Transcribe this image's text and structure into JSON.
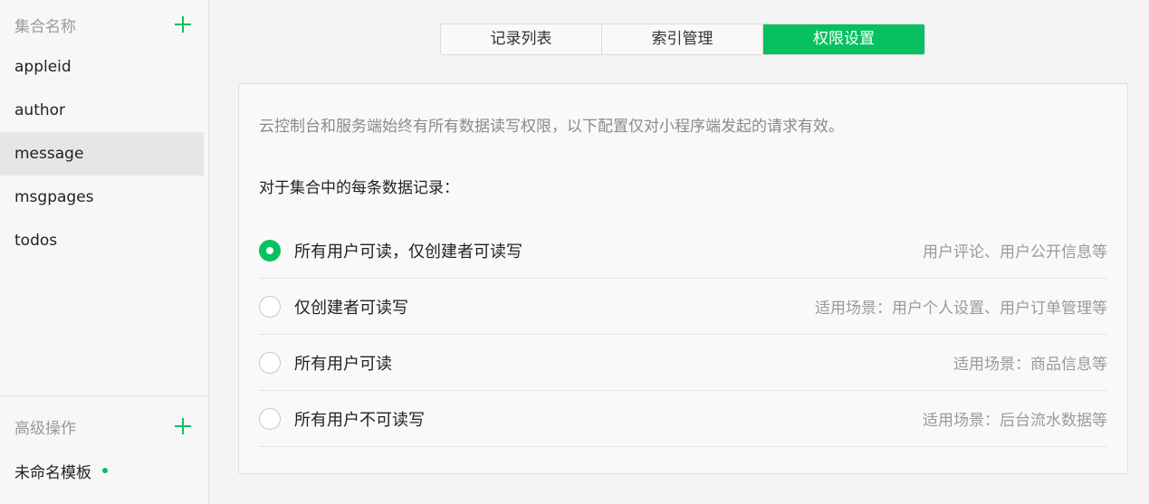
{
  "sidebar": {
    "collections_header": "集合名称",
    "collections": [
      "appleid",
      "author",
      "message",
      "msgpages",
      "todos"
    ],
    "active_collection": "message",
    "advanced_header": "高级操作",
    "template_label": "未命名模板"
  },
  "tabs": [
    {
      "label": "记录列表",
      "active": false
    },
    {
      "label": "索引管理",
      "active": false
    },
    {
      "label": "权限设置",
      "active": true
    }
  ],
  "panel": {
    "note": "云控制台和服务端始终有所有数据读写权限，以下配置仅对小程序端发起的请求有效。",
    "question": "对于集合中的每条数据记录：",
    "options": [
      {
        "label": "所有用户可读，仅创建者可读写",
        "hint": "用户评论、用户公开信息等",
        "checked": true
      },
      {
        "label": "仅创建者可读写",
        "hint": "适用场景：用户个人设置、用户订单管理等",
        "checked": false
      },
      {
        "label": "所有用户可读",
        "hint": "适用场景：商品信息等",
        "checked": false
      },
      {
        "label": "所有用户不可读写",
        "hint": "适用场景：后台流水数据等",
        "checked": false
      }
    ]
  },
  "colors": {
    "accent": "#07c160"
  }
}
